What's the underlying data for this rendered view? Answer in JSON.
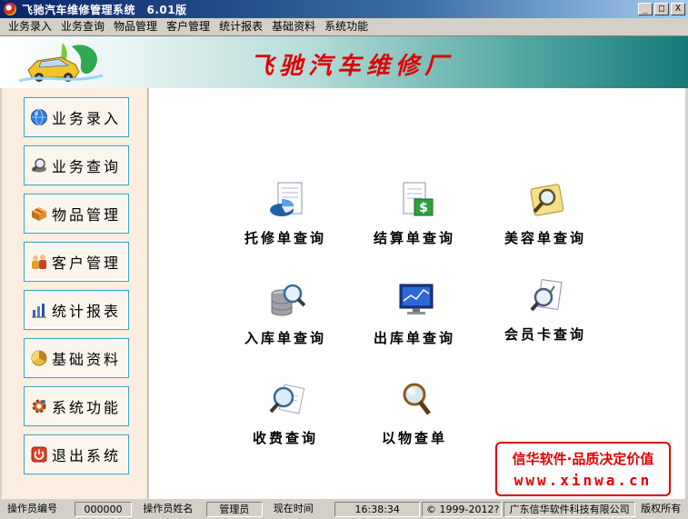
{
  "window": {
    "title": "飞驰汽车维修管理系统　6.01版",
    "min_symbol": "_",
    "max_symbol": "□",
    "close_symbol": "X"
  },
  "menu": [
    "业务录入",
    "业务查询",
    "物品管理",
    "客户管理",
    "统计报表",
    "基础资料",
    "系统功能"
  ],
  "banner": {
    "company": "飞驰汽车维修厂"
  },
  "sidebar": [
    {
      "label": "业务录入",
      "icon": "globe-icon"
    },
    {
      "label": "业务查询",
      "icon": "magnifier-icon"
    },
    {
      "label": "物品管理",
      "icon": "box-icon"
    },
    {
      "label": "客户管理",
      "icon": "people-icon"
    },
    {
      "label": "统计报表",
      "icon": "bar-chart-icon"
    },
    {
      "label": "基础资料",
      "icon": "data-icon"
    },
    {
      "label": "系统功能",
      "icon": "gear-icon"
    },
    {
      "label": "退出系统",
      "icon": "power-icon"
    }
  ],
  "tiles": [
    {
      "label": "托修单查询",
      "icon": "pie-document-icon"
    },
    {
      "label": "结算单查询",
      "icon": "dollar-document-icon"
    },
    {
      "label": "美容单查询",
      "icon": "search-note-icon"
    },
    {
      "label": "入库单查询",
      "icon": "database-search-icon"
    },
    {
      "label": "出库单查询",
      "icon": "monitor-chart-icon"
    },
    {
      "label": "会员卡查询",
      "icon": "member-card-icon"
    },
    {
      "label": "收费查询",
      "icon": "fee-search-icon"
    },
    {
      "label": "以物查单",
      "icon": "magnifier-icon"
    }
  ],
  "promo": {
    "line1": "信华软件·品质决定价值",
    "line2": "www.xinwa.cn"
  },
  "status": {
    "operator_id_label": "操作员编号",
    "operator_id": "000000",
    "operator_name_label": "操作员姓名",
    "operator_name": "管理员",
    "time_label": "现在时间",
    "time": "16:38:34",
    "copyright": "©  1999-2012?",
    "company": "广东信华软件科技有限公司",
    "rights": "版权所有"
  },
  "colors": {
    "title_gradient_start": "#0a246a",
    "banner_teal": "#167a78",
    "company_red": "#e00000",
    "sidebar_bg": "#fbeee0",
    "button_border": "#39a0b8"
  }
}
